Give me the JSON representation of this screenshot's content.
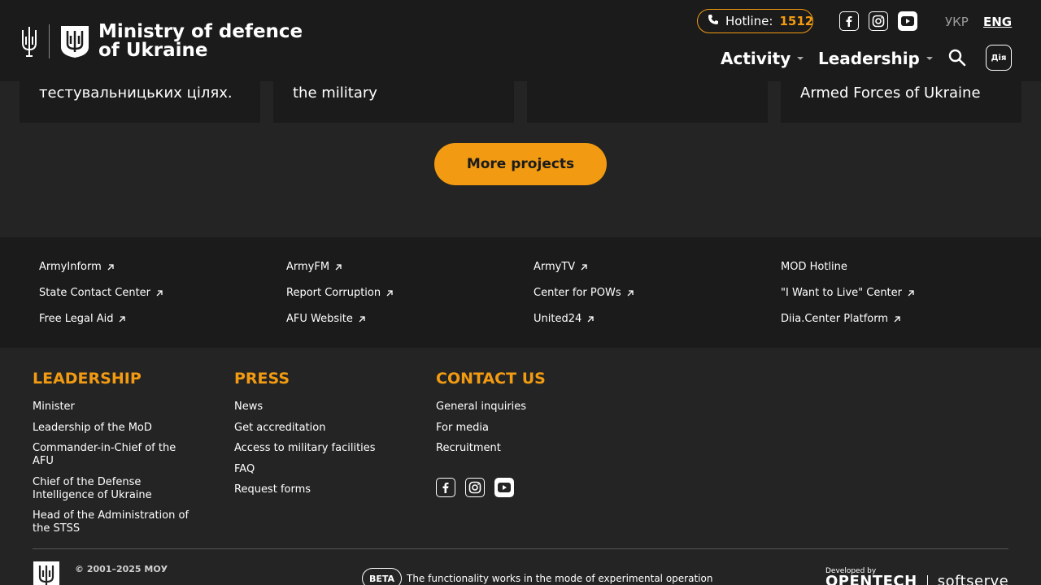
{
  "header": {
    "logo_line1": "Ministry of defence",
    "logo_line2": "of Ukraine",
    "hotline_label": "Hotline:",
    "hotline_number": "1512",
    "lang_ukr": "УКР",
    "lang_eng": "ENG",
    "nav_activity": "Activity",
    "nav_leadership": "Leadership",
    "diia_label": "Дія"
  },
  "cards": [
    {
      "text": "тестувальницьких цілях."
    },
    {
      "text": "the military"
    },
    {
      "text": ""
    },
    {
      "text": "Armed Forces of Ukraine"
    }
  ],
  "more_projects": "More projects",
  "links": {
    "col1": [
      "ArmyInform",
      "State Contact Center",
      "Free Legal Aid"
    ],
    "col2": [
      "ArmyFM",
      "Report Corruption",
      "AFU Website"
    ],
    "col3": [
      "ArmyTV",
      "Center for POWs",
      "United24"
    ],
    "col4": [
      "MOD Hotline",
      "\"I Want to Live\" Center",
      "Diia.Center Platform"
    ]
  },
  "footer": {
    "leadership_title": "LEADERSHIP",
    "leadership_items": [
      "Minister",
      "Leadership of the MoD",
      "Commander-in-Chief of the AFU",
      "Chief of the Defense Intelligence of Ukraine",
      "Head of the Administration of the STSS"
    ],
    "press_title": "PRESS",
    "press_items": [
      "News",
      "Get accreditation",
      "Access to military facilities",
      "FAQ",
      "Request forms"
    ],
    "contact_title": "CONTACT US",
    "contact_items": [
      "General inquiries",
      "For media",
      "Recruitment"
    ],
    "copyright": "© 2001–2025 МОУ",
    "beta_badge": "BETA",
    "beta_text": "The functionality works in the mode of experimental operation",
    "developed_by": "Developed by",
    "dev_logo_1": "OPENTECH",
    "dev_logo_2": "softserve"
  },
  "colors": {
    "accent": "#f29b12",
    "header_bg": "#1b1b1b",
    "page_bg": "#242424"
  }
}
